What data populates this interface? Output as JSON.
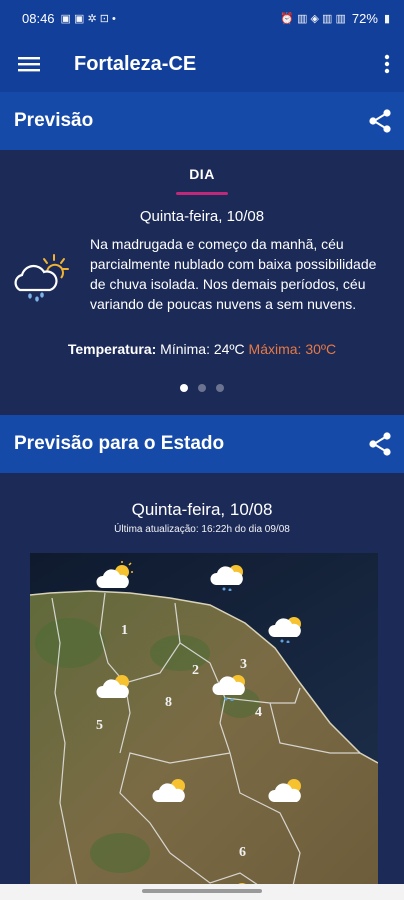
{
  "status": {
    "time": "08:46",
    "battery": "72%"
  },
  "appbar": {
    "title": "Fortaleza-CE"
  },
  "forecast": {
    "title": "Previsão",
    "tab": "DIA",
    "date": "Quinta-feira, 10/08",
    "description": "Na madrugada e começo da manhã, céu parcialmente nublado com baixa possibilidade de chuva isolada. Nos demais períodos, céu variando de poucas nuvens a sem nuvens.",
    "temp_label": "Temperatura:",
    "min": "Mínima: 24ºC",
    "max": "Máxima: 30ºC",
    "pages": 3,
    "active_page": 1
  },
  "state": {
    "title": "Previsão para o Estado",
    "date": "Quinta-feira, 10/08",
    "updated": "Última atualização: 16:22h do dia 09/08",
    "regions": [
      "1",
      "2",
      "3",
      "4",
      "5",
      "6",
      "8"
    ]
  },
  "colors": {
    "appbar": "#123f9a",
    "card": "#1c2a58",
    "accent": "#c0287a",
    "max_temp": "#e67a45"
  }
}
